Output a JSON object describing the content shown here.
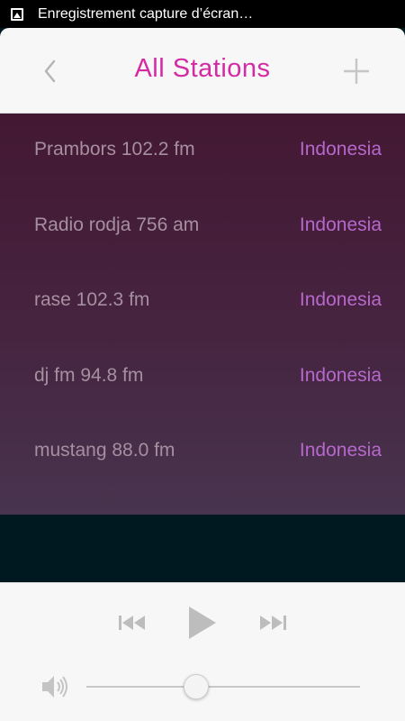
{
  "status_bar": {
    "notification_text": "Enregistrement capture d’écran…",
    "icon": "screenshot-icon"
  },
  "header": {
    "title": "All Stations",
    "back_icon": "chevron-left-icon",
    "add_icon": "plus-icon",
    "title_color": "#d42aa4"
  },
  "stations": [
    {
      "name": "Prambors 102.2 fm",
      "country": "Indonesia"
    },
    {
      "name": "Radio rodja 756 am",
      "country": "Indonesia"
    },
    {
      "name": "rase 102.3 fm",
      "country": "Indonesia"
    },
    {
      "name": "dj fm 94.8 fm",
      "country": "Indonesia"
    },
    {
      "name": "mustang 88.0 fm",
      "country": "Indonesia"
    }
  ],
  "player": {
    "prev_icon": "skip-previous-icon",
    "play_icon": "play-icon",
    "next_icon": "skip-next-icon",
    "volume_icon": "speaker-icon",
    "volume_level": 0.4
  },
  "colors": {
    "accent": "#d42aa4",
    "country_text": "#b768cc",
    "station_text": "#a58fa0"
  }
}
